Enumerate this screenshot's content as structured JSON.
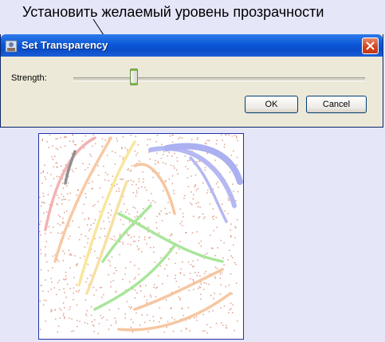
{
  "annotation": {
    "text": "Установить желаемый уровень прозрачности"
  },
  "dialog": {
    "title": "Set Transparency",
    "strength_label": "Strength:",
    "strength_value": 0.2,
    "ok_label": "OK",
    "cancel_label": "Cancel"
  },
  "colors": {
    "titlebar": "#0b58d8",
    "dialog_bg": "#ece9d8",
    "page_bg": "#e5e6f8",
    "canvas_border": "#2233aa",
    "thumb_accent": "#7ec24a"
  },
  "icons": [
    "app-icon",
    "close-icon"
  ],
  "drawing": {
    "content": "freehand colored strokes with speckle pattern"
  }
}
